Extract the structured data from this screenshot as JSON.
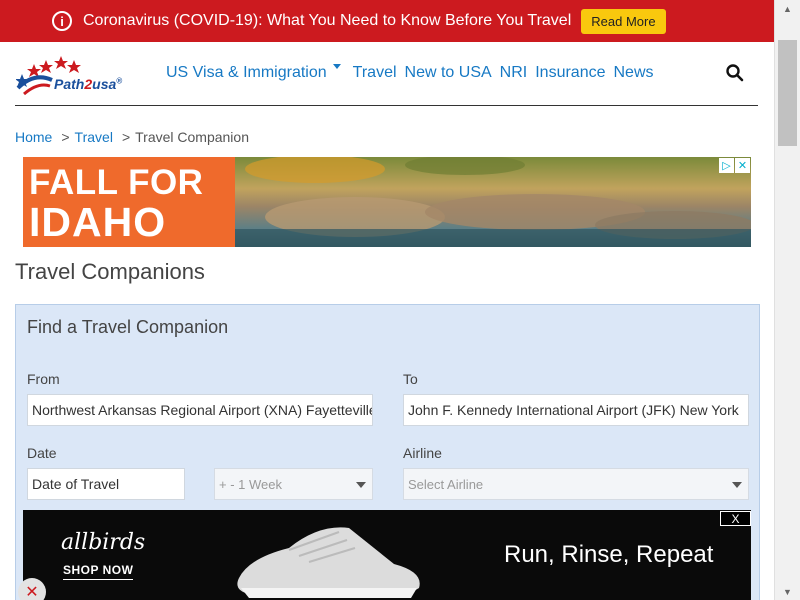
{
  "covid_banner": {
    "text": "Coronavirus (COVID-19): What You Need to Know Before You Travel",
    "button": "Read More",
    "icon": "info-circle-icon"
  },
  "logo": {
    "part1": "Path",
    "part2": "2",
    "part3": "usa",
    "trademark": "®"
  },
  "nav": {
    "items": [
      "US Visa & Immigration",
      "Travel",
      "New to USA",
      "NRI",
      "Insurance",
      "News"
    ],
    "search_icon": "search-icon"
  },
  "breadcrumb": {
    "home": "Home",
    "travel": "Travel",
    "current": "Travel Companion",
    "separator": ">"
  },
  "ad_top": {
    "line1": "FALL FOR",
    "line2": "IDAHO",
    "badge_info": "▷",
    "badge_close": "✕"
  },
  "page": {
    "title": "Travel Companions"
  },
  "form": {
    "title": "Find a Travel Companion",
    "from_label": "From",
    "from_value": "Northwest Arkansas Regional Airport (XNA) Fayetteville",
    "to_label": "To",
    "to_value": "John F. Kennedy International Airport (JFK) New York",
    "date_label": "Date",
    "date_placeholder": "Date of Travel",
    "range_value": "+ - 1 Week",
    "airline_label": "Airline",
    "airline_placeholder": "Select Airline"
  },
  "ad_bottom": {
    "brand": "allbirds",
    "cta": "SHOP NOW",
    "tagline": "Run, Rinse, Repeat",
    "close": "X"
  },
  "colors": {
    "red": "#cc1a1f",
    "link": "#1779c4",
    "yellow": "#f9c80e",
    "panel": "#dbe7f7"
  }
}
